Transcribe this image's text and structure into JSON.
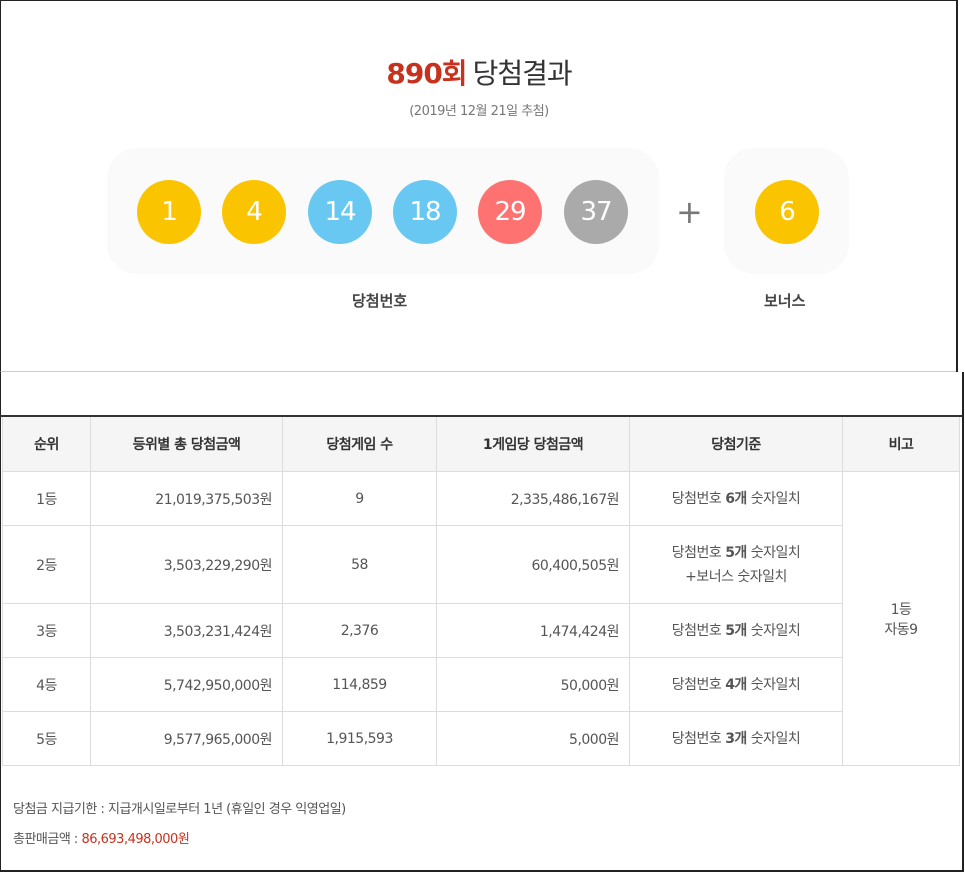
{
  "header": {
    "round": "890회",
    "title": "당첨결과",
    "date": "(2019년 12월 21일 추첨)"
  },
  "numbers": {
    "main": [
      {
        "value": "1",
        "color": "#fbc400"
      },
      {
        "value": "4",
        "color": "#fbc400"
      },
      {
        "value": "14",
        "color": "#69c8f2"
      },
      {
        "value": "18",
        "color": "#69c8f2"
      },
      {
        "value": "29",
        "color": "#ff7272"
      },
      {
        "value": "37",
        "color": "#aaaaaa"
      }
    ],
    "plus": "+",
    "bonus": {
      "value": "6",
      "color": "#fbc400"
    },
    "main_label": "당첨번호",
    "bonus_label": "보너스"
  },
  "table": {
    "headers": [
      "순위",
      "등위별 총 당첨금액",
      "당첨게임 수",
      "1게임당 당첨금액",
      "당첨기준",
      "비고"
    ],
    "rows": [
      {
        "rank": "1등",
        "total": "21,019,375,503원",
        "count": "9",
        "per_game": "2,335,486,167원",
        "criteria_prefix": "당첨번호 ",
        "criteria_num": "6개",
        "criteria_suffix": " 숫자일치",
        "criteria_line2": ""
      },
      {
        "rank": "2등",
        "total": "3,503,229,290원",
        "count": "58",
        "per_game": "60,400,505원",
        "criteria_prefix": "당첨번호 ",
        "criteria_num": "5개",
        "criteria_suffix": " 숫자일치",
        "criteria_line2": "+보너스 숫자일치"
      },
      {
        "rank": "3등",
        "total": "3,503,231,424원",
        "count": "2,376",
        "per_game": "1,474,424원",
        "criteria_prefix": "당첨번호 ",
        "criteria_num": "5개",
        "criteria_suffix": " 숫자일치",
        "criteria_line2": ""
      },
      {
        "rank": "4등",
        "total": "5,742,950,000원",
        "count": "114,859",
        "per_game": "50,000원",
        "criteria_prefix": "당첨번호 ",
        "criteria_num": "4개",
        "criteria_suffix": " 숫자일치",
        "criteria_line2": ""
      },
      {
        "rank": "5등",
        "total": "9,577,965,000원",
        "count": "1,915,593",
        "per_game": "5,000원",
        "criteria_prefix": "당첨번호 ",
        "criteria_num": "3개",
        "criteria_suffix": " 숫자일치",
        "criteria_line2": ""
      }
    ],
    "note_line1": "1등",
    "note_line2": "자동9"
  },
  "footer": {
    "payout_deadline": "당첨금 지급기한 : 지급개시일로부터 1년 (휴일인 경우 익영업일)",
    "total_sales_label": "총판매금액 : ",
    "total_sales_value": "86,693,498,000원"
  },
  "colors": {
    "accent": "#c7321e",
    "yellow": "#fbc400",
    "blue": "#69c8f2",
    "red": "#ff7272",
    "gray": "#aaaaaa"
  }
}
